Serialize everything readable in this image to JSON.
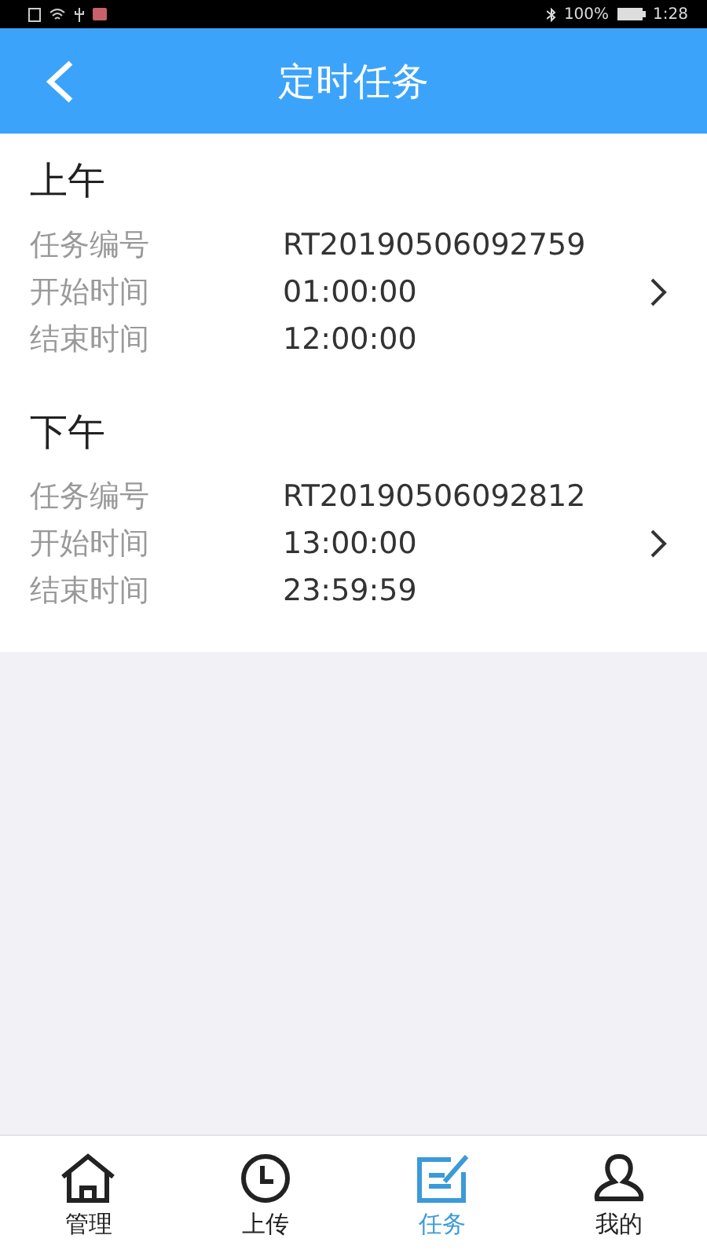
{
  "status_bar": {
    "battery": "100%",
    "time": "1:28"
  },
  "header": {
    "title": "定时任务"
  },
  "tasks": [
    {
      "title": "上午",
      "fields": [
        {
          "label": "任务编号",
          "value": "RT20190506092759"
        },
        {
          "label": "开始时间",
          "value": "01:00:00"
        },
        {
          "label": "结束时间",
          "value": "12:00:00"
        }
      ]
    },
    {
      "title": "下午",
      "fields": [
        {
          "label": "任务编号",
          "value": "RT20190506092812"
        },
        {
          "label": "开始时间",
          "value": "13:00:00"
        },
        {
          "label": "结束时间",
          "value": "23:59:59"
        }
      ]
    }
  ],
  "tabbar": [
    {
      "kind": "home",
      "label": "管理",
      "selected": false
    },
    {
      "kind": "clock",
      "label": "上传",
      "selected": false
    },
    {
      "kind": "task",
      "label": "任务",
      "selected": true
    },
    {
      "kind": "user",
      "label": "我的",
      "selected": false
    }
  ]
}
